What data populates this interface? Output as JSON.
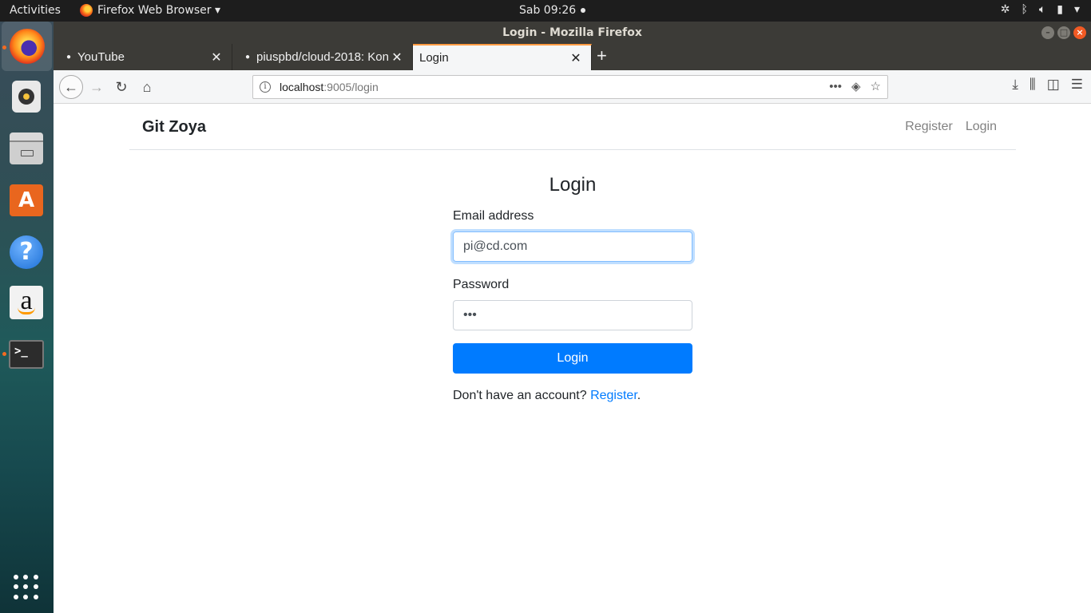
{
  "topbar": {
    "activities": "Activities",
    "app_menu": "Firefox Web Browser ▾",
    "clock": "Sab 09:26"
  },
  "window": {
    "title": "Login - Mozilla Firefox"
  },
  "tabs": [
    {
      "label": "YouTube"
    },
    {
      "label": "piuspbd/cloud-2018: Kon"
    },
    {
      "label": "Login"
    }
  ],
  "url": {
    "host": "localhost",
    "path": ":9005/login"
  },
  "site": {
    "brand": "Git Zoya",
    "nav": {
      "register": "Register",
      "login": "Login"
    }
  },
  "form": {
    "title": "Login",
    "email_label": "Email address",
    "email_value": "pi@cd.com",
    "password_label": "Password",
    "password_value": "•••",
    "submit_label": "Login",
    "no_account_text": "Don't have an account? ",
    "register_link": "Register",
    "trailing": "."
  },
  "colors": {
    "primary": "#007bff",
    "focus_border": "#80bdff"
  }
}
